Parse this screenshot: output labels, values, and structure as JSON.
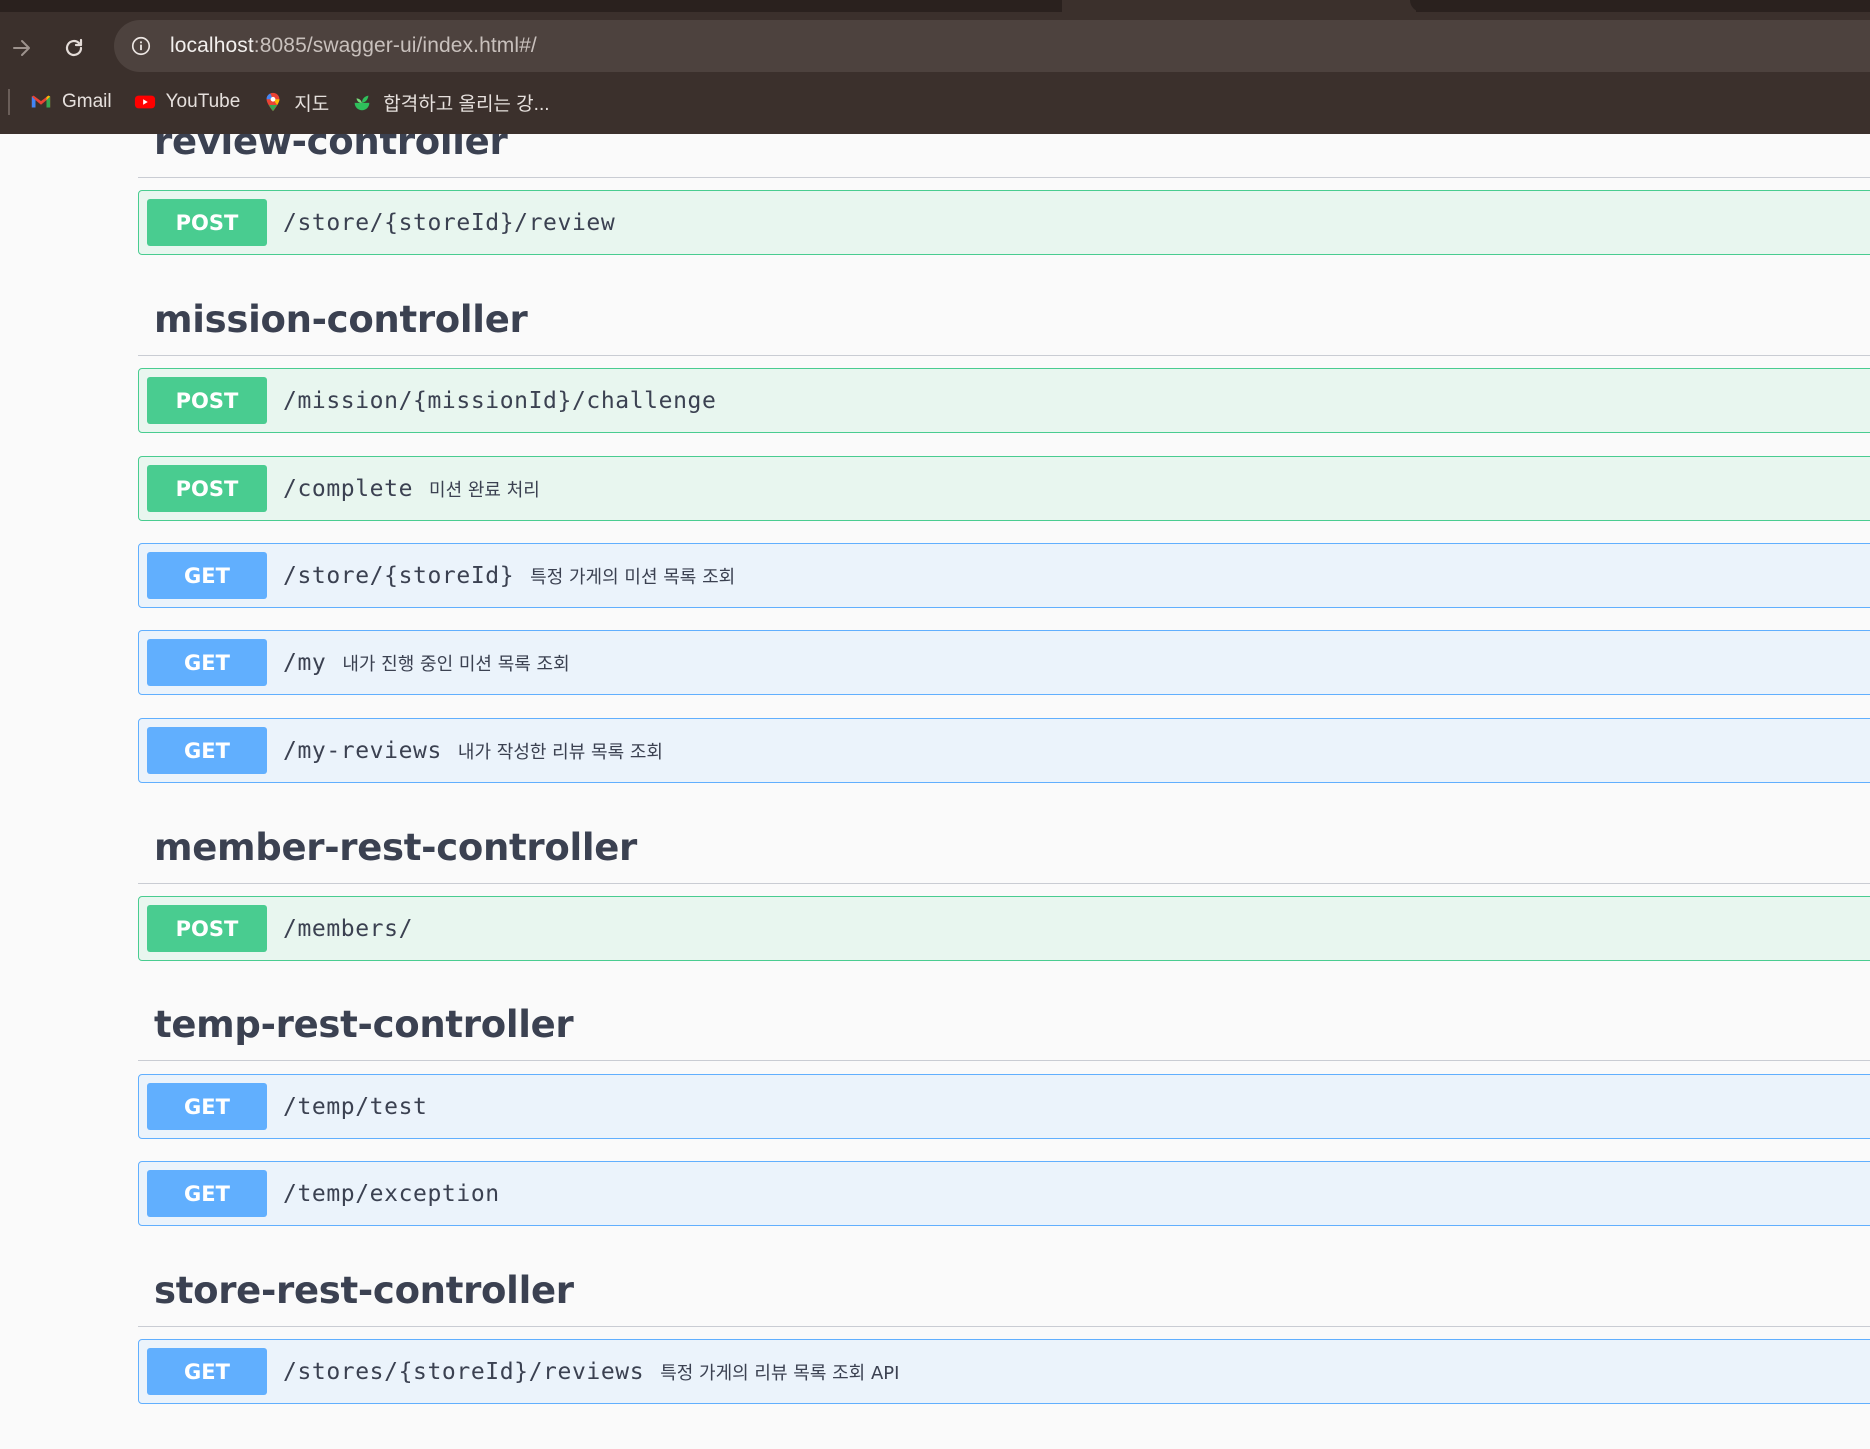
{
  "browser": {
    "url_host": "localhost",
    "url_rest": ":8085/swagger-ui/index.html#/",
    "bookmarks": [
      {
        "label": "Gmail",
        "icon": "gmail-icon"
      },
      {
        "label": "YouTube",
        "icon": "youtube-icon"
      },
      {
        "label": "지도",
        "icon": "maps-icon"
      },
      {
        "label": "합격하고 올리는 강...",
        "icon": "sprout-icon"
      }
    ]
  },
  "colors": {
    "post": "#49cc90",
    "get": "#61affe",
    "title": "#3b4151"
  },
  "sections": [
    {
      "title": "review-controller",
      "operations": [
        {
          "method": "POST",
          "path": "/store/{storeId}/review",
          "summary": ""
        }
      ]
    },
    {
      "title": "mission-controller",
      "operations": [
        {
          "method": "POST",
          "path": "/mission/{missionId}/challenge",
          "summary": ""
        },
        {
          "method": "POST",
          "path": "/complete",
          "summary": "미션 완료 처리"
        },
        {
          "method": "GET",
          "path": "/store/{storeId}",
          "summary": "특정 가게의 미션 목록 조회"
        },
        {
          "method": "GET",
          "path": "/my",
          "summary": "내가 진행 중인 미션 목록 조회"
        },
        {
          "method": "GET",
          "path": "/my-reviews",
          "summary": "내가 작성한 리뷰 목록 조회"
        }
      ]
    },
    {
      "title": "member-rest-controller",
      "operations": [
        {
          "method": "POST",
          "path": "/members/",
          "summary": ""
        }
      ]
    },
    {
      "title": "temp-rest-controller",
      "operations": [
        {
          "method": "GET",
          "path": "/temp/test",
          "summary": ""
        },
        {
          "method": "GET",
          "path": "/temp/exception",
          "summary": ""
        }
      ]
    },
    {
      "title": "store-rest-controller",
      "operations": [
        {
          "method": "GET",
          "path": "/stores/{storeId}/reviews",
          "summary": "특정 가게의 리뷰 목록 조회 API"
        }
      ]
    }
  ]
}
